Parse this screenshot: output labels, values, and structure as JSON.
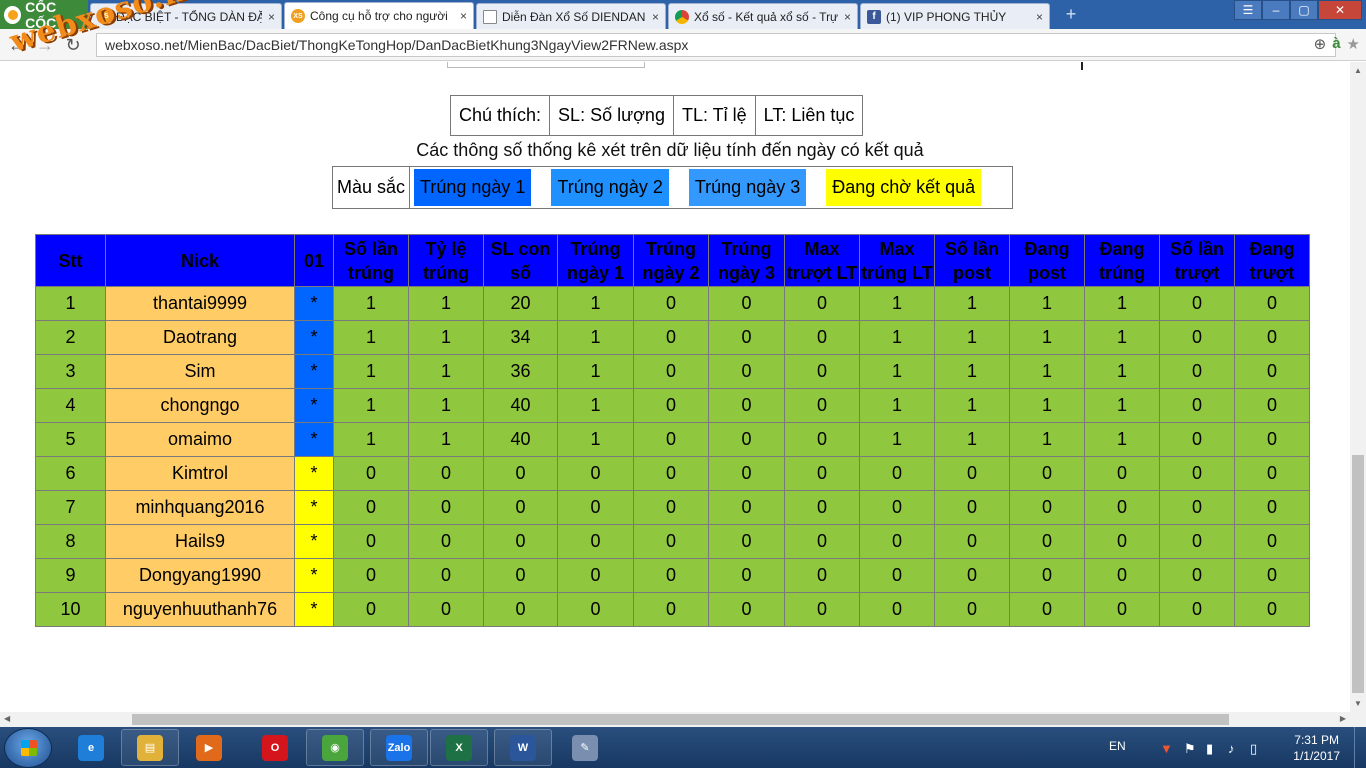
{
  "browser": {
    "brand": "CỐC CỐC",
    "tabs": [
      {
        "label": "ĐẶC BIỆT - TỔNG DÀN ĐẶC",
        "icon": "xs-icon",
        "active": false
      },
      {
        "label": "Công cụ hỗ trợ cho người",
        "icon": "xs-icon",
        "active": true
      },
      {
        "label": "Diễn Đàn Xổ Số DIENDAN",
        "icon": "document-icon",
        "active": false
      },
      {
        "label": "Xổ số - Kết quả xổ số - Trực",
        "icon": "chrome-icon",
        "active": false
      },
      {
        "label": "(1) VIP PHONG THỦY",
        "icon": "facebook-icon",
        "active": false
      }
    ],
    "url": "webxoso.net/MienBac/DacBiet/ThongKeTongHop/DanDacBietKhung3NgayView2FRNew.aspx",
    "watermark": "webxoso.net"
  },
  "legend": {
    "title": "Chú thích:",
    "items": [
      "SL: Số lượng",
      "TL: Tỉ lệ",
      "LT: Liên tục"
    ]
  },
  "stats_note": "Các thông số thống kê xét trên dữ liệu tính đến ngày có kết quả",
  "colors": {
    "label": "Màu sắc",
    "items": [
      {
        "label": "Trúng ngày 1",
        "color": "#0066ff"
      },
      {
        "label": "Trúng ngày 2",
        "color": "#1e90ff"
      },
      {
        "label": "Trúng ngày 3",
        "color": "#3399ff"
      },
      {
        "label": "Đang chờ kết quả",
        "color": "#ffff00"
      }
    ]
  },
  "table": {
    "headers": [
      "Stt",
      "Nick",
      "01",
      "Số lần trúng",
      "Tỷ lệ trúng",
      "SL con số",
      "Trúng ngày 1",
      "Trúng ngày 2",
      "Trúng ngày 3",
      "Max trượt LT",
      "Max trúng LT",
      "Số lần post",
      "Đang post",
      "Đang trúng",
      "Số lần trượt",
      "Đang trượt"
    ],
    "rows": [
      {
        "cells": [
          "1",
          "thantai9999",
          "*",
          "1",
          "1",
          "20",
          "1",
          "0",
          "0",
          "0",
          "1",
          "1",
          "1",
          "1",
          "0",
          "0"
        ],
        "status": "hit"
      },
      {
        "cells": [
          "2",
          "Daotrang",
          "*",
          "1",
          "1",
          "34",
          "1",
          "0",
          "0",
          "0",
          "1",
          "1",
          "1",
          "1",
          "0",
          "0"
        ],
        "status": "hit"
      },
      {
        "cells": [
          "3",
          "Sim",
          "*",
          "1",
          "1",
          "36",
          "1",
          "0",
          "0",
          "0",
          "1",
          "1",
          "1",
          "1",
          "0",
          "0"
        ],
        "status": "hit"
      },
      {
        "cells": [
          "4",
          "chongngo",
          "*",
          "1",
          "1",
          "40",
          "1",
          "0",
          "0",
          "0",
          "1",
          "1",
          "1",
          "1",
          "0",
          "0"
        ],
        "status": "hit"
      },
      {
        "cells": [
          "5",
          "omaimo",
          "*",
          "1",
          "1",
          "40",
          "1",
          "0",
          "0",
          "0",
          "1",
          "1",
          "1",
          "1",
          "0",
          "0"
        ],
        "status": "hit"
      },
      {
        "cells": [
          "6",
          "Kimtrol",
          "*",
          "0",
          "0",
          "0",
          "0",
          "0",
          "0",
          "0",
          "0",
          "0",
          "0",
          "0",
          "0",
          "0"
        ],
        "status": "wait"
      },
      {
        "cells": [
          "7",
          "minhquang2016",
          "*",
          "0",
          "0",
          "0",
          "0",
          "0",
          "0",
          "0",
          "0",
          "0",
          "0",
          "0",
          "0",
          "0"
        ],
        "status": "wait"
      },
      {
        "cells": [
          "8",
          "Hails9",
          "*",
          "0",
          "0",
          "0",
          "0",
          "0",
          "0",
          "0",
          "0",
          "0",
          "0",
          "0",
          "0",
          "0"
        ],
        "status": "wait"
      },
      {
        "cells": [
          "9",
          "Dongyang1990",
          "*",
          "0",
          "0",
          "0",
          "0",
          "0",
          "0",
          "0",
          "0",
          "0",
          "0",
          "0",
          "0",
          "0"
        ],
        "status": "wait"
      },
      {
        "cells": [
          "10",
          "nguyenhuuthanh76",
          "*",
          "0",
          "0",
          "0",
          "0",
          "0",
          "0",
          "0",
          "0",
          "0",
          "0",
          "0",
          "0",
          "0"
        ],
        "status": "wait"
      }
    ]
  },
  "taskbar": {
    "apps": [
      {
        "name": "ie-icon",
        "glyph": "e",
        "color": "#1e7ed8"
      },
      {
        "name": "file-explorer-icon",
        "glyph": "▤",
        "color": "#e0b23a"
      },
      {
        "name": "media-player-icon",
        "glyph": "▶",
        "color": "#e06a1a"
      },
      {
        "name": "opera-icon",
        "glyph": "O",
        "color": "#d4161c"
      },
      {
        "name": "coccoc-icon",
        "glyph": "◉",
        "color": "#4aa53c"
      },
      {
        "name": "zalo-icon",
        "glyph": "Zalo",
        "color": "#1a73e8"
      },
      {
        "name": "excel-icon",
        "glyph": "X",
        "color": "#1e7145"
      },
      {
        "name": "word-icon",
        "glyph": "W",
        "color": "#2b579a"
      },
      {
        "name": "paint-icon",
        "glyph": "✎",
        "color": "#7a8fb0"
      }
    ],
    "lang": "EN",
    "time": "7:31 PM",
    "date": "1/1/2017"
  }
}
